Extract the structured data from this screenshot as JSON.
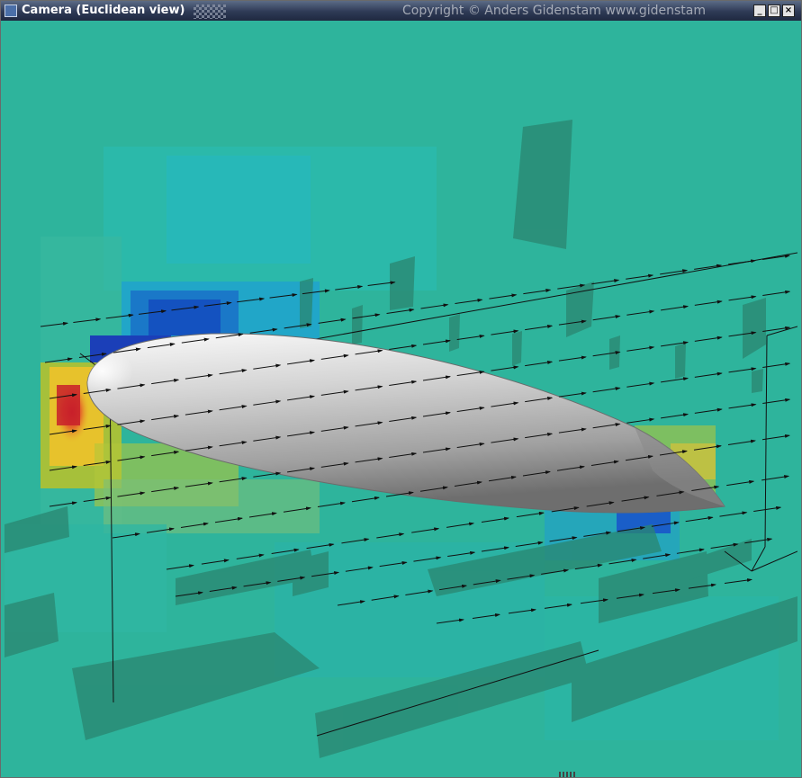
{
  "window": {
    "title": "Camera (Euclidean view)",
    "copyright": "Copyright © Anders Gidenstam  www.gidenstam",
    "controls": {
      "minimize_icon": "minimize-icon",
      "maximize_icon": "maximize-icon",
      "close_icon": "close-icon"
    }
  },
  "viewport": {
    "content": "3D airfoil flow visualization with velocity vector field and pressure colored slices",
    "colors": {
      "background": "#2eb49c",
      "slice_shadow": "#2a8670",
      "high_pressure": "#c8202a",
      "mid_pressure": "#e7c22c",
      "low_pressure": "#1f3fc4",
      "airfoil_light": "#f4f4f4",
      "airfoil_dark": "#7a7a7a"
    }
  }
}
